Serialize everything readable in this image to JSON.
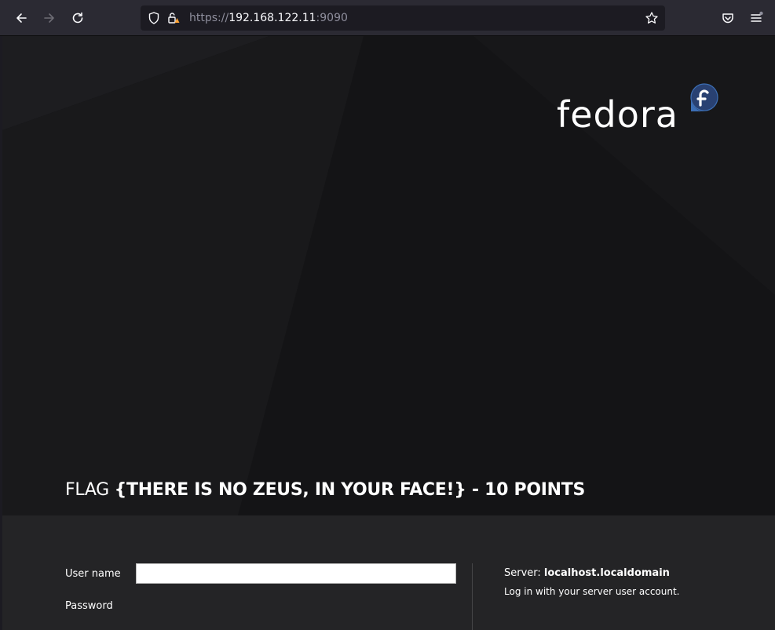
{
  "browser": {
    "url_scheme": "https://",
    "url_host": "192.168.122.11",
    "url_port": ":9090",
    "icons": {
      "back": "arrow-left-icon",
      "forward": "arrow-right-icon",
      "reload": "reload-icon",
      "tracking": "shield-icon",
      "security": "lock-warning-icon",
      "bookmark": "star-icon",
      "pocket": "pocket-icon",
      "menu": "hamburger-menu-icon"
    }
  },
  "page": {
    "logo_text": "fedora",
    "flag_prefix": "FLAG ",
    "flag_text": "{THERE IS NO ZEUS, IN YOUR FACE!} - 10 POINTS"
  },
  "login": {
    "username_label": "User name",
    "username_value": "",
    "password_label": "Password",
    "server_label": "Server: ",
    "server_name": "localhost.localdomain",
    "server_help": "Log in with your server user account."
  },
  "colors": {
    "toolbar_bg": "#2b2a33",
    "urlbar_bg": "#1c1b22",
    "page_bg": "#141416",
    "login_bg": "#242426",
    "fedora_blue": "#3c6eb4",
    "fedora_dark_blue": "#294172"
  }
}
